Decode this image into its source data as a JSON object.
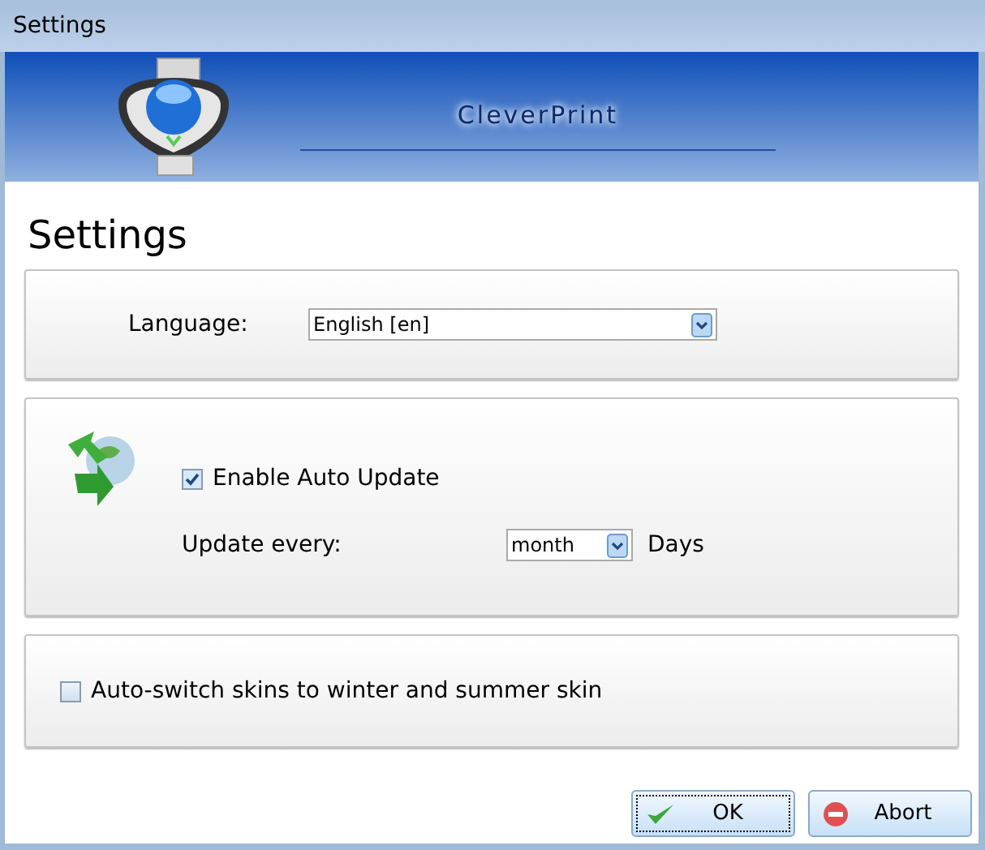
{
  "window": {
    "title": "Settings"
  },
  "banner": {
    "product_name": "CleverPrint"
  },
  "heading": "Settings",
  "language": {
    "label": "Language:",
    "value": "English [en]"
  },
  "auto_update": {
    "checkbox_label": "Enable Auto Update",
    "checked": true,
    "interval_label": "Update every:",
    "interval_value": "month",
    "unit": "Days"
  },
  "skins": {
    "label": "Auto-switch skins to winter and summer skin",
    "checked": false
  },
  "buttons": [
    {
      "kind": "ok",
      "label": "OK",
      "focused": true
    },
    {
      "kind": "abort",
      "label": "Abort",
      "focused": false
    }
  ]
}
